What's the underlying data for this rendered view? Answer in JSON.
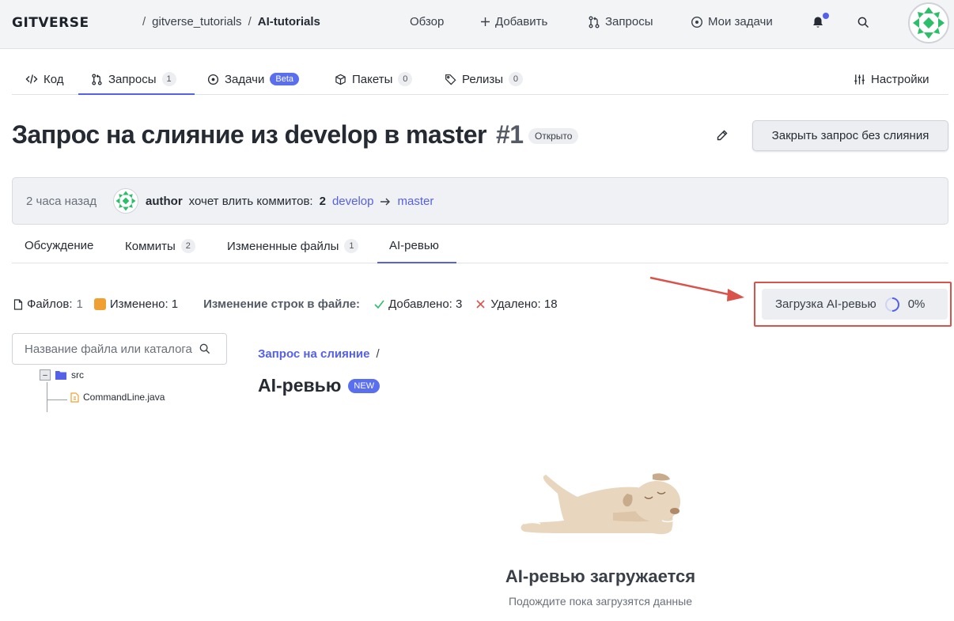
{
  "header": {
    "logo": "GITVERSE",
    "breadcrumb": {
      "owner": "gitverse_tutorials",
      "sep": "/",
      "repo": "AI-tutorials"
    },
    "nav": [
      {
        "label": "Обзор",
        "icon": "none"
      },
      {
        "label": "Добавить",
        "icon": "plus-icon"
      },
      {
        "label": "Запросы",
        "icon": "pull-request-icon"
      },
      {
        "label": "Мои задачи",
        "icon": "issue-icon"
      }
    ]
  },
  "repo_tabs": [
    {
      "label": "Код",
      "icon": "code-icon"
    },
    {
      "label": "Запросы",
      "icon": "pull-request-icon",
      "count": "1",
      "active": true
    },
    {
      "label": "Задачи",
      "icon": "issue-icon",
      "badge": "Beta"
    },
    {
      "label": "Пакеты",
      "icon": "package-icon",
      "count": "0"
    },
    {
      "label": "Релизы",
      "icon": "tag-icon",
      "count": "0"
    },
    {
      "label": "Настройки",
      "icon": "settings-sliders-icon"
    }
  ],
  "pr": {
    "title": "Запрос на слияние из develop в master",
    "number": "#1",
    "status": "Открыто",
    "close_button": "Закрыть запрос без слияния",
    "time": "2 часа назад",
    "author": "author",
    "wants_text": "хочет влить коммитов:",
    "commit_count": "2",
    "source_branch": "develop",
    "target_branch": "master"
  },
  "sub_tabs": [
    {
      "label": "Обсуждение"
    },
    {
      "label": "Коммиты",
      "count": "2"
    },
    {
      "label": "Измененные файлы",
      "count": "1"
    },
    {
      "label": "AI-ревью",
      "active": true
    }
  ],
  "stats": {
    "files_label": "Файлов:",
    "files_value": "1",
    "changed_label": "Изменено: 1",
    "lines_label": "Изменение строк в файле:",
    "added_label": "Добавлено: 3",
    "deleted_label": "Удалено: 18"
  },
  "ai_loading": {
    "label": "Загрузка AI-ревью",
    "percent": "0%"
  },
  "file_tree": {
    "search_placeholder": "Название файла или каталога",
    "folder": "src",
    "file": "CommandLine.java"
  },
  "content": {
    "breadcrumb": "Запрос на слияние",
    "breadcrumb_sep": "/",
    "title": "AI-ревью",
    "new_badge": "NEW",
    "loading_title": "AI-ревью загружается",
    "loading_subtitle": "Подождите пока загрузятся данные"
  },
  "colors": {
    "accent": "#5561e6",
    "highlight_red": "#d9534a",
    "changed_orange": "#f0a030"
  }
}
